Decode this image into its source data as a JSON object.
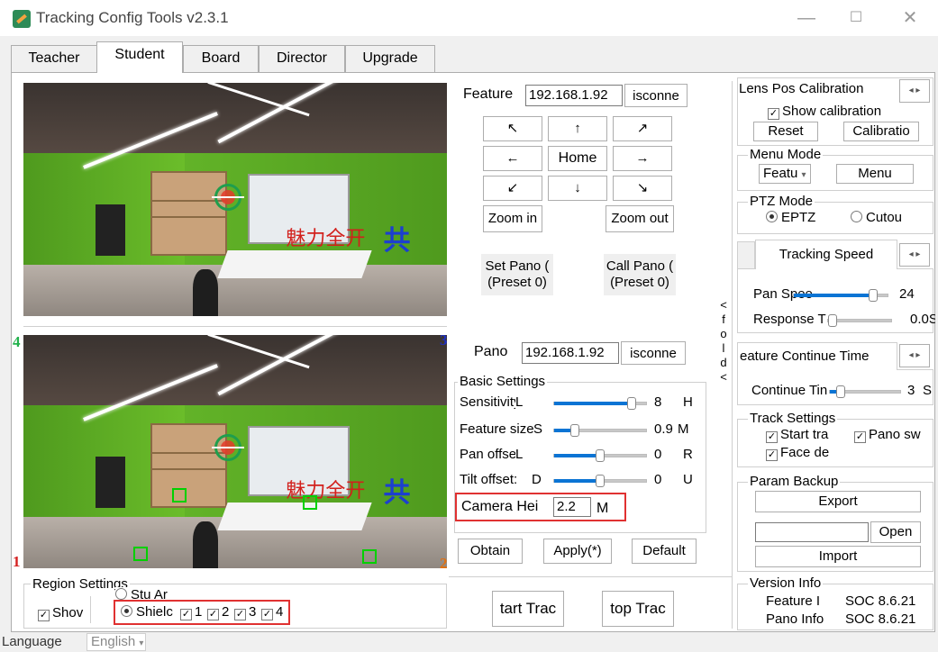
{
  "window": {
    "title": "Tracking Config Tools v2.3.1",
    "minimize": "—",
    "maximize": "☐",
    "close": "✕"
  },
  "tabs": [
    "Teacher",
    "Student",
    "Board",
    "Director",
    "Upgrade"
  ],
  "feature": {
    "label": "Feature",
    "ip": "192.168.1.92",
    "disconnect": "isconne",
    "arrows": {
      "ul": "↖",
      "up": "↑",
      "ur": "↗",
      "left": "←",
      "home": "Home",
      "right": "→",
      "dl": "↙",
      "down": "↓",
      "dr": "↘"
    },
    "zoom_in": "Zoom in",
    "zoom_out": "Zoom out",
    "set_pano": "Set Pano (\n(Preset 0)",
    "call_pano": "Call Pano (\n(Preset 0)"
  },
  "pano": {
    "label": "Pano",
    "ip": "192.168.1.92",
    "disconnect": "isconne"
  },
  "fold_label": [
    "<",
    "f",
    "o",
    "l",
    "d",
    "<"
  ],
  "corner_labels": {
    "c1": "1",
    "c2": "2",
    "c3": "3",
    "c4": "4"
  },
  "cam_text": {
    "red": "魅力全开",
    "blue": "共"
  },
  "basic_settings": {
    "title": "Basic Settings",
    "rows": [
      {
        "label": "Sensitivity",
        "left": "L",
        "value": "8",
        "right": "H",
        "fraction": 0.88
      },
      {
        "label": "Feature size",
        "left": "S",
        "value": "0.9",
        "right": "M",
        "fraction": 0.2
      },
      {
        "label": "Pan offset",
        "left": "L",
        "value": "0",
        "right": "R",
        "fraction": 0.5
      },
      {
        "label": "Tilt offset:",
        "left": "D",
        "value": "0",
        "right": "U",
        "fraction": 0.5
      }
    ],
    "camera_height_label": "Camera Hei",
    "camera_height_value": "2.2",
    "camera_height_unit": "M"
  },
  "actions": {
    "obtain": "Obtain",
    "apply": "Apply(*)",
    "default": "Default",
    "start": "tart Trac",
    "stop": "top Trac"
  },
  "region": {
    "title": "Region Settings",
    "show": "Shov",
    "stu_area": "Stu Ar",
    "shield": "Shielc",
    "numbers": [
      "1",
      "2",
      "3",
      "4"
    ]
  },
  "right": {
    "lens": {
      "title": "Lens Pos Calibration",
      "show": "Show calibration",
      "reset": "Reset",
      "calibration": "Calibratio"
    },
    "menu_mode": {
      "title": "Menu Mode",
      "select": "Featu",
      "menu": "Menu"
    },
    "ptz_mode": {
      "title": "PTZ Mode",
      "eptz": "EPTZ",
      "cutout": "Cutou"
    },
    "tracking_speed": {
      "tab": "Tracking Speed",
      "pan_label": "Pan Spee",
      "pan_value": "24",
      "pan_fraction": 0.88,
      "resp_label": "Response T",
      "resp_value": "0.0S",
      "resp_fraction": 0.0
    },
    "feature_time": {
      "tab": "eature Continue Time",
      "label": "Continue Tin",
      "value": "3",
      "unit": "S",
      "fraction": 0.1
    },
    "track_settings": {
      "title": "Track Settings",
      "start": "Start tra",
      "pano": "Pano sw",
      "face": "Face de"
    },
    "param_backup": {
      "title": "Param Backup",
      "export": "Export",
      "open": "Open",
      "import": "Import"
    },
    "version": {
      "title": "Version Info",
      "feature_label": "Feature I",
      "feature_value": "SOC 8.6.21",
      "pano_label": "Pano Info",
      "pano_value": "SOC 8.6.21"
    }
  },
  "language": {
    "label": "Language",
    "value": "English"
  },
  "colors": {
    "accent": "#0b74d4",
    "highlight": "#e03131",
    "target": "#1f9e4d"
  }
}
